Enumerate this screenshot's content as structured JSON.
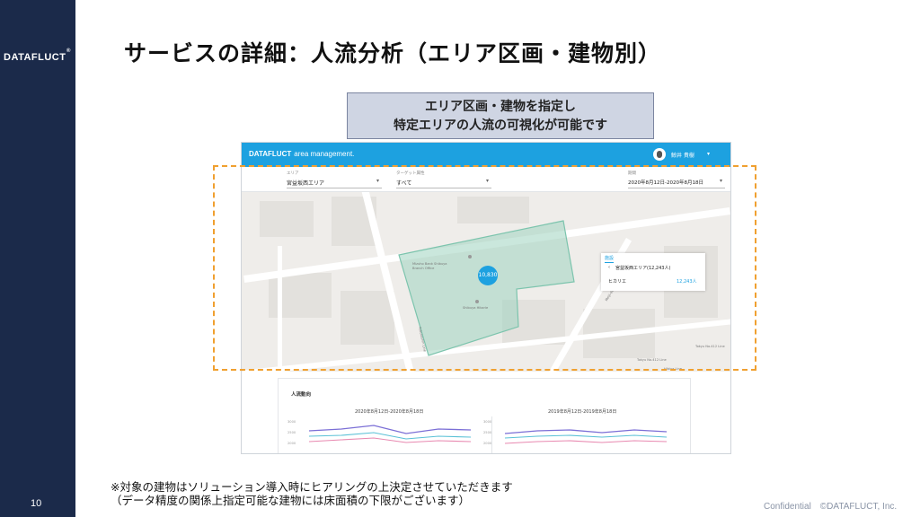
{
  "slide": {
    "title": "サービスの詳細：人流分析（エリア区画・建物別）",
    "page_number": "10",
    "confidential": "Confidential　©DATAFLUCT, Inc.",
    "logo_text": "DATAFLUCT",
    "logo_tm": "®"
  },
  "callout": {
    "line1": "エリア区画・建物を指定し",
    "line2": "特定エリアの人流の可視化が可能です"
  },
  "app": {
    "logo": "DATAFLUCT",
    "product": "area management.",
    "user_name": "鯨井 貴樹"
  },
  "filters": {
    "area_label": "エリア",
    "area_value": "宮益坂西エリア",
    "target_label": "ターゲット属性",
    "target_value": "すべて",
    "period_label": "期間",
    "period_value": "2020年8月12日-2020年8月18日"
  },
  "side_panel": {
    "tab": "施設",
    "area_row": "宮益坂西エリア(12,243人)",
    "building": "ヒカリエ",
    "building_value": "12,243人"
  },
  "map_labels": {
    "pin": "10,830",
    "shibuya_hikarie": "Shibuya Hikarie",
    "mizuho": "Mizuho Bank Shibuya Branch Office",
    "tokyu_line": "Tokyu No.412 Line",
    "hibiya_line": "Hibiya Line",
    "fukutoshin_line": "Fukutoshin Line",
    "meiji_dori": "Meiji-dori",
    "tokyu_line2": "Tokyu No.412 Line"
  },
  "chart_section": {
    "title": "人流動向",
    "date_left": "2020年8月12日-2020年8月18日",
    "date_right": "2019年8月12日-2019年8月18日",
    "yticks": [
      "3000",
      "2500",
      "2000"
    ]
  },
  "note": {
    "line1": "※対象の建物はソリューション導入時にヒアリングの上決定させていただきます",
    "line2": "（データ精度の関係上指定可能な建物には床面積の下限がございます）"
  },
  "colors": {
    "sidebar": "#1b2a4a",
    "accent": "#1da1e0",
    "highlight_border": "#f0a030",
    "callout_bg": "#cfd5e3"
  }
}
